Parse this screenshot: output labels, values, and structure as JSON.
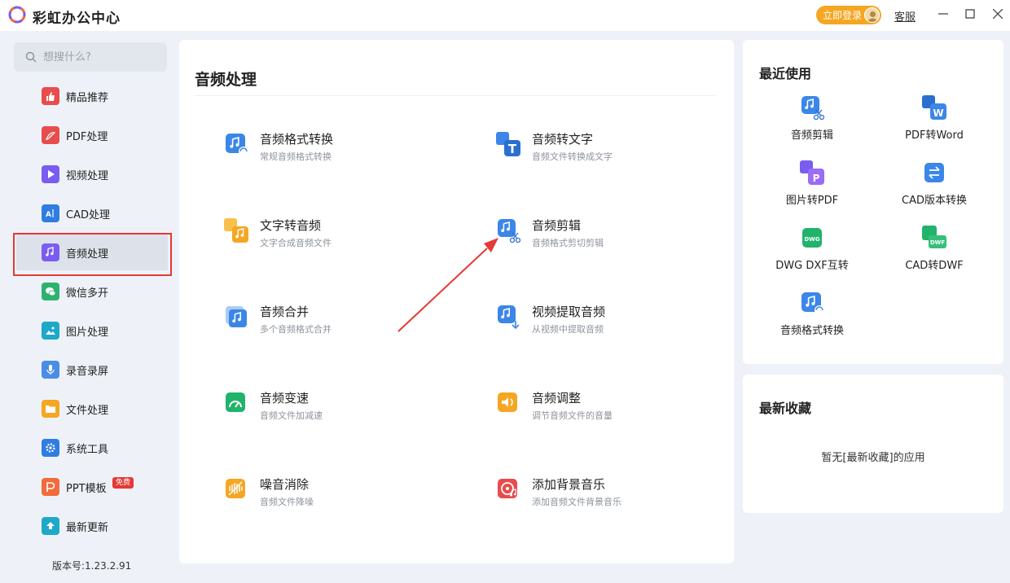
{
  "app": {
    "title": "彩虹办公中心",
    "login_label": "立即登录",
    "service_label": "客服"
  },
  "sidebar": {
    "search_placeholder": "想搜什么?",
    "items": [
      {
        "label": "精品推荐",
        "icon": "thumbs-up-icon",
        "color": "#e84c4c"
      },
      {
        "label": "PDF处理",
        "icon": "pdf-icon",
        "color": "#e84c4c"
      },
      {
        "label": "视频处理",
        "icon": "play-icon",
        "color": "#7b5cf0"
      },
      {
        "label": "CAD处理",
        "icon": "cad-icon",
        "color": "#2f7de1"
      },
      {
        "label": "音频处理",
        "icon": "music-icon",
        "color": "#7b5cf0"
      },
      {
        "label": "微信多开",
        "icon": "wechat-icon",
        "color": "#2db36f"
      },
      {
        "label": "图片处理",
        "icon": "image-icon",
        "color": "#1ea8c9"
      },
      {
        "label": "录音录屏",
        "icon": "microphone-icon",
        "color": "#4a8de6"
      },
      {
        "label": "文件处理",
        "icon": "folder-icon",
        "color": "#f5a623"
      },
      {
        "label": "系统工具",
        "icon": "gear-icon",
        "color": "#2f7de1"
      },
      {
        "label": "PPT模板",
        "icon": "ppt-icon",
        "color": "#f26b3a",
        "badge": "免费"
      },
      {
        "label": "最新更新",
        "icon": "upload-icon",
        "color": "#1ea8c9"
      }
    ],
    "version": "版本号:1.23.2.91"
  },
  "main": {
    "title": "音频处理",
    "tools": [
      {
        "name": "音频格式转换",
        "desc": "常规音频格式转换",
        "icon": "audio-convert-icon"
      },
      {
        "name": "音频转文字",
        "desc": "音频文件转换成文字",
        "icon": "audio-to-text-icon"
      },
      {
        "name": "文字转音频",
        "desc": "文字合成音频文件",
        "icon": "text-to-audio-icon"
      },
      {
        "name": "音频剪辑",
        "desc": "音频格式剪切剪辑",
        "icon": "audio-cut-icon"
      },
      {
        "name": "音频合并",
        "desc": "多个音频格式合并",
        "icon": "audio-merge-icon"
      },
      {
        "name": "视频提取音频",
        "desc": "从视频中提取音频",
        "icon": "extract-audio-icon"
      },
      {
        "name": "音频变速",
        "desc": "音频文件加减速",
        "icon": "audio-speed-icon"
      },
      {
        "name": "音频调整",
        "desc": "调节音频文件的音量",
        "icon": "volume-icon"
      },
      {
        "name": "噪音消除",
        "desc": "音频文件降噪",
        "icon": "noise-reduction-icon"
      },
      {
        "name": "添加背景音乐",
        "desc": "添加音频文件背景音乐",
        "icon": "background-music-icon"
      }
    ]
  },
  "recent": {
    "title": "最近使用",
    "items": [
      {
        "label": "音频剪辑",
        "icon": "audio-cut-icon"
      },
      {
        "label": "PDF转Word",
        "icon": "pdf-to-word-icon"
      },
      {
        "label": "图片转PDF",
        "icon": "image-to-pdf-icon"
      },
      {
        "label": "CAD版本转换",
        "icon": "cad-version-icon"
      },
      {
        "label": "DWG DXF互转",
        "icon": "dwg-dxf-icon"
      },
      {
        "label": "CAD转DWF",
        "icon": "cad-to-dwf-icon"
      },
      {
        "label": "音频格式转换",
        "icon": "audio-convert-icon"
      }
    ]
  },
  "favorites": {
    "title": "最新收藏",
    "empty_text": "暂无[最新收藏]的应用"
  },
  "colors": {
    "accent": "#2f7de1",
    "highlight": "#e53935",
    "login": "#f5a623"
  }
}
